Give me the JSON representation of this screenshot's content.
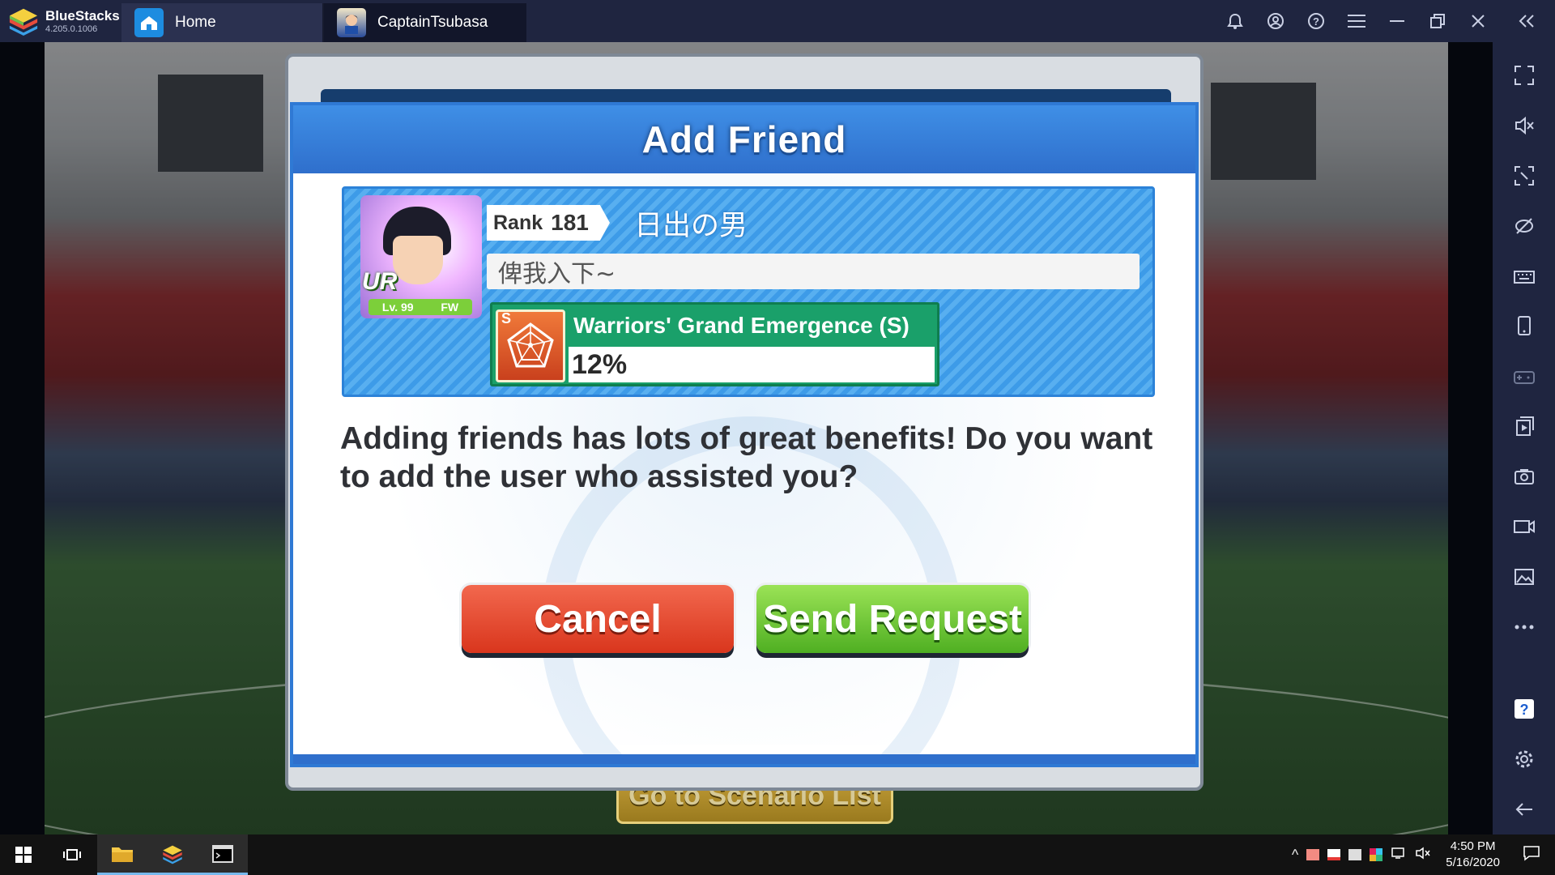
{
  "app": {
    "name": "BlueStacks",
    "version": "4.205.0.1006"
  },
  "tabs": [
    {
      "label": "Home",
      "icon": "home-icon"
    },
    {
      "label": "CaptainTsubasa",
      "icon": "game-thumbnail"
    }
  ],
  "title_controls": [
    "bell-icon",
    "account-icon",
    "help-icon",
    "menu-icon",
    "minimize-icon",
    "restore-icon",
    "close-icon",
    "collapse-sidebar-icon"
  ],
  "sidebar": [
    "fullscreen-icon",
    "volume-mute-icon",
    "resize-icon",
    "eye-off-icon",
    "keyboard-icon",
    "phone-icon",
    "gamepad-icon",
    "install-apk-icon",
    "camera-icon",
    "record-icon",
    "media-folder-icon",
    "more-icon",
    "help-icon",
    "settings-icon",
    "back-icon"
  ],
  "dialog": {
    "title": "Add Friend",
    "profile": {
      "rank_label": "Rank",
      "rank": "181",
      "name": "日出の男",
      "comment": "俾我入下~",
      "card_rarity": "UR",
      "card_level": "Lv. 99",
      "card_position": "FW",
      "skill_grade": "S",
      "skill_name": "Warriors' Grand Emergence (S)",
      "skill_progress": "12%"
    },
    "message": "Adding friends has lots of great benefits! Do you want to add the user who assisted you?",
    "cancel_label": "Cancel",
    "send_label": "Send Request"
  },
  "background_button": "Go to Scenario List",
  "taskbar": {
    "items": [
      "windows-start-icon",
      "task-view-icon",
      "file-explorer-icon",
      "bluestacks-icon",
      "terminal-icon"
    ],
    "time": "4:50 PM",
    "date": "5/16/2020"
  },
  "colors": {
    "titlebar": "#1f2540",
    "dialog_blue": "#2f79d4",
    "cancel_red": "#e0442a",
    "send_green": "#6cc63a"
  }
}
